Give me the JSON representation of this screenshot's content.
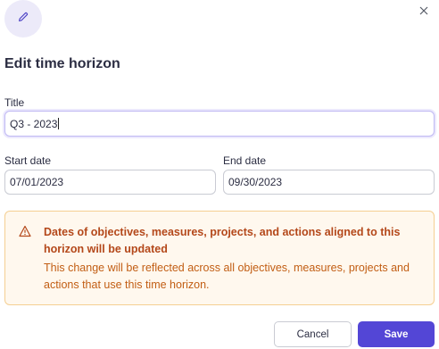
{
  "dialog": {
    "title": "Edit time horizon",
    "header_icon": "pencil-icon",
    "close_icon": "close-icon"
  },
  "form": {
    "title_label": "Title",
    "title_value": "Q3 - 2023",
    "start_date_label": "Start date",
    "start_date_value": "07/01/2023",
    "end_date_label": "End date",
    "end_date_value": "09/30/2023"
  },
  "alert": {
    "icon": "warning-icon",
    "heading": "Dates of objectives, measures, projects, and actions aligned to this horizon will be updated",
    "body": "This change will be reflected across all objectives, measures, projects and actions that use this time horizon."
  },
  "actions": {
    "cancel_label": "Cancel",
    "save_label": "Save"
  },
  "colors": {
    "primary": "#5346d6",
    "alert_background": "#fff8ee",
    "alert_border": "#f5cf92",
    "alert_text": "#b4481a"
  }
}
